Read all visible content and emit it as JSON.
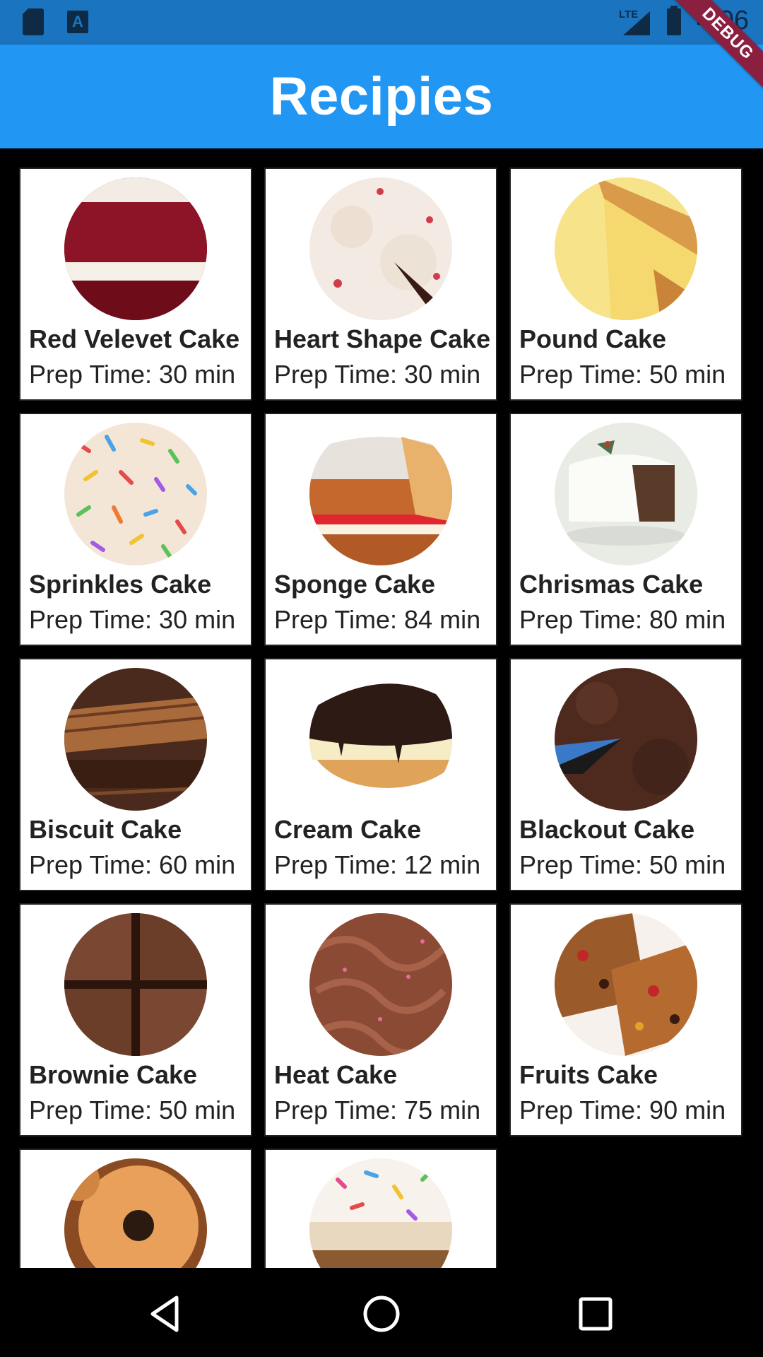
{
  "status_bar": {
    "network": "LTE",
    "time": "4:06",
    "icons": [
      "sd-card-icon",
      "app-a-icon",
      "signal-icon",
      "battery-charging-icon"
    ]
  },
  "app_bar": {
    "title": "Recipies"
  },
  "debug_banner": "DEBUG",
  "recipes": [
    {
      "name": "Red Velevet Cake",
      "prep": "Prep Time: 30 min",
      "image": "red-velvet-cake-image"
    },
    {
      "name": "Heart Shape Cake",
      "prep": "Prep Time: 30 min",
      "image": "heart-shape-cake-image"
    },
    {
      "name": "Pound Cake",
      "prep": "Prep Time: 50 min",
      "image": "pound-cake-image"
    },
    {
      "name": "Sprinkles Cake",
      "prep": "Prep Time: 30 min",
      "image": "sprinkles-cake-image"
    },
    {
      "name": "Sponge Cake",
      "prep": "Prep Time: 84 min",
      "image": "sponge-cake-image"
    },
    {
      "name": "Chrismas Cake",
      "prep": "Prep Time: 80 min",
      "image": "christmas-cake-image"
    },
    {
      "name": "Biscuit Cake",
      "prep": "Prep Time: 60 min",
      "image": "biscuit-cake-image"
    },
    {
      "name": "Cream Cake",
      "prep": "Prep Time: 12 min",
      "image": "cream-cake-image"
    },
    {
      "name": "Blackout Cake",
      "prep": "Prep Time: 50 min",
      "image": "blackout-cake-image"
    },
    {
      "name": "Brownie Cake",
      "prep": "Prep Time: 50 min",
      "image": "brownie-cake-image"
    },
    {
      "name": "Heat Cake",
      "prep": "Prep Time: 75 min",
      "image": "heat-cake-image"
    },
    {
      "name": "Fruits Cake",
      "prep": "Prep Time: 90 min",
      "image": "fruits-cake-image"
    },
    {
      "name": "",
      "prep": "",
      "image": "donut-image"
    },
    {
      "name": "",
      "prep": "",
      "image": "sprinkle-bar-cake-image"
    }
  ],
  "nav_bar": {
    "buttons": [
      "back-icon",
      "home-icon",
      "recents-icon"
    ]
  },
  "colors": {
    "status_bar": "#1b74bf",
    "app_bar": "#2196f3",
    "background": "#000000",
    "card": "#ffffff",
    "debug": "#8a1f3f"
  }
}
